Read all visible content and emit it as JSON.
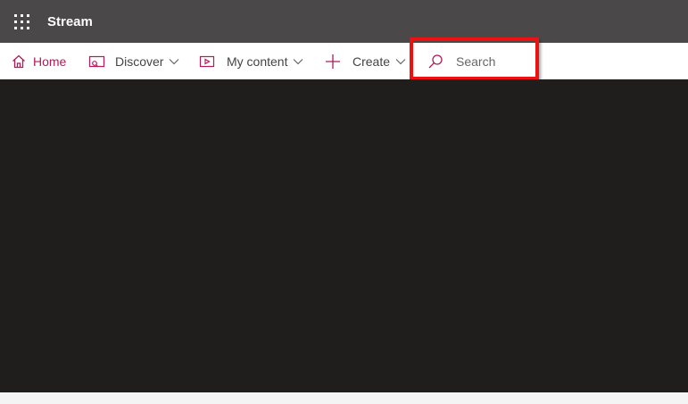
{
  "app": {
    "title": "Stream"
  },
  "nav": {
    "home_label": "Home",
    "discover_label": "Discover",
    "my_content_label": "My content",
    "create_label": "Create"
  },
  "search": {
    "placeholder": "Search",
    "value": ""
  },
  "icons": {
    "app_launcher": "waffle-icon",
    "home": "home-icon",
    "discover": "discover-icon",
    "my_content": "video-icon",
    "create": "plus-icon",
    "dropdown": "chevron-down-icon",
    "search": "search-icon"
  },
  "colors": {
    "topbar_bg": "#4a4848",
    "accent": "#b4195a",
    "main_bg": "#201e1d",
    "highlight": "#ee1111"
  }
}
